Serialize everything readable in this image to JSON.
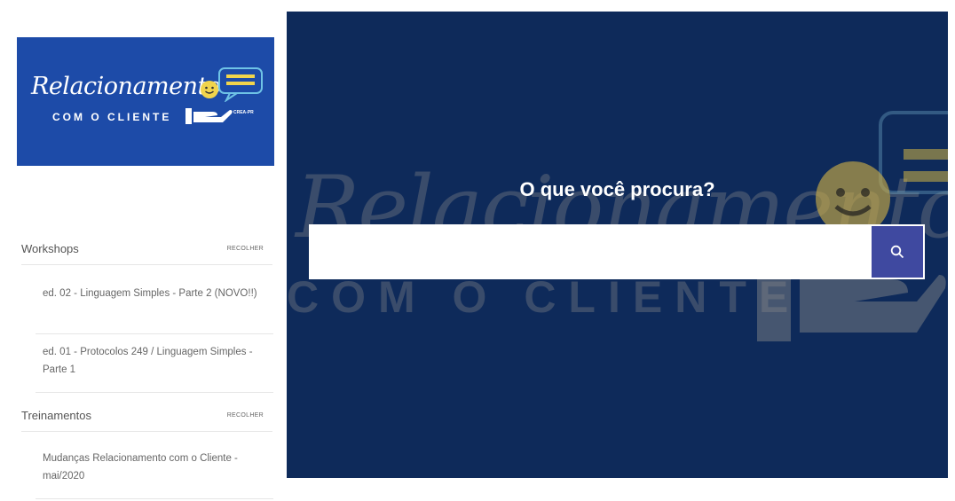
{
  "logo": {
    "script_text": "Relacionamento",
    "sub_text": "COM O CLIENTE",
    "tag_text": "CREA-PR"
  },
  "sidebar": {
    "sections": [
      {
        "title": "Workshops",
        "collapse_label": "RECOLHER",
        "items": [
          "ed. 02 - Linguagem Simples - Parte 2 (NOVO!!)",
          "ed. 01 - Protocolos 249 / Linguagem Simples - Parte 1"
        ]
      },
      {
        "title": "Treinamentos",
        "collapse_label": "RECOLHER",
        "items": [
          "Mudanças Relacionamento com o Cliente - mai/2020"
        ]
      }
    ]
  },
  "hero": {
    "title": "O que você procura?",
    "search_placeholder": "",
    "watermark_script": "Relacionamento",
    "watermark_sub": "COM O CLIENTE"
  },
  "colors": {
    "hero_bg": "#0e2a5a",
    "logo_bg": "#1d4ba8",
    "search_button": "#3f49a0",
    "smiley": "#e8c84a"
  },
  "icons": {
    "search": "search-icon",
    "smiley": "smiley-icon",
    "chat_bubble": "chat-bubble-icon",
    "hand": "hand-icon"
  }
}
